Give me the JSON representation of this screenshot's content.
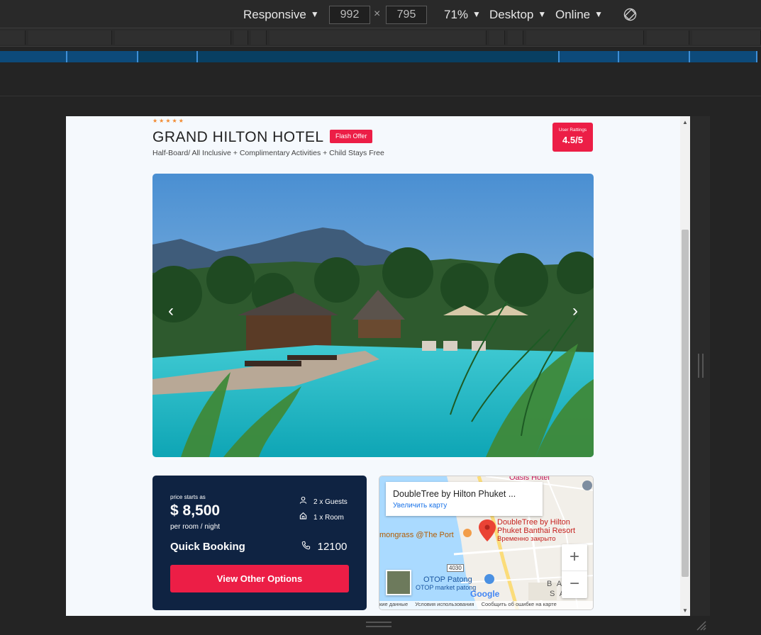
{
  "toolbar": {
    "device": "Responsive",
    "width": "992",
    "height": "795",
    "times": "×",
    "zoom": "71%",
    "mode": "Desktop",
    "network": "Online"
  },
  "hotel": {
    "stars": "★★★★★",
    "name": "GRAND HILTON HOTEL",
    "badge": "Flash Offer",
    "subtitle": "Half-Board/ All Inclusive + Complimentary Activities + Child Stays Free",
    "rating_label": "User Rattings",
    "rating_value": "4.5/5"
  },
  "gallery": {
    "prev": "‹",
    "next": "›"
  },
  "booking": {
    "price_label": "price starts as",
    "price": "$ 8,500",
    "price_unit": "per room / night",
    "guests": "2 x Guests",
    "rooms": "1 x Room",
    "quick_booking": "Quick Booking",
    "phone": "12100",
    "button": "View Other Options"
  },
  "map": {
    "card_title": "DoubleTree by Hilton Phuket ...",
    "card_link": "Увеличить карту",
    "marker_line1": "DoubleTree by Hilton",
    "marker_line2": "Phuket Banthai Resort",
    "marker_status": "Временно закрыто",
    "place_oasis": "Oasis Hotel",
    "place_lemongrass": "mongrass @The Port",
    "road_number": "4030",
    "place_otop": "OTOP Patong",
    "place_otop_market": "OTOP market patong",
    "google_logo": "Google",
    "area_ba": "B A",
    "area_sa": "S A",
    "zoom_in": "+",
    "zoom_out": "−",
    "footer_data": "кие данные",
    "footer_terms": "Условия использования",
    "footer_report": "Сообщить об ошибке на карте"
  }
}
